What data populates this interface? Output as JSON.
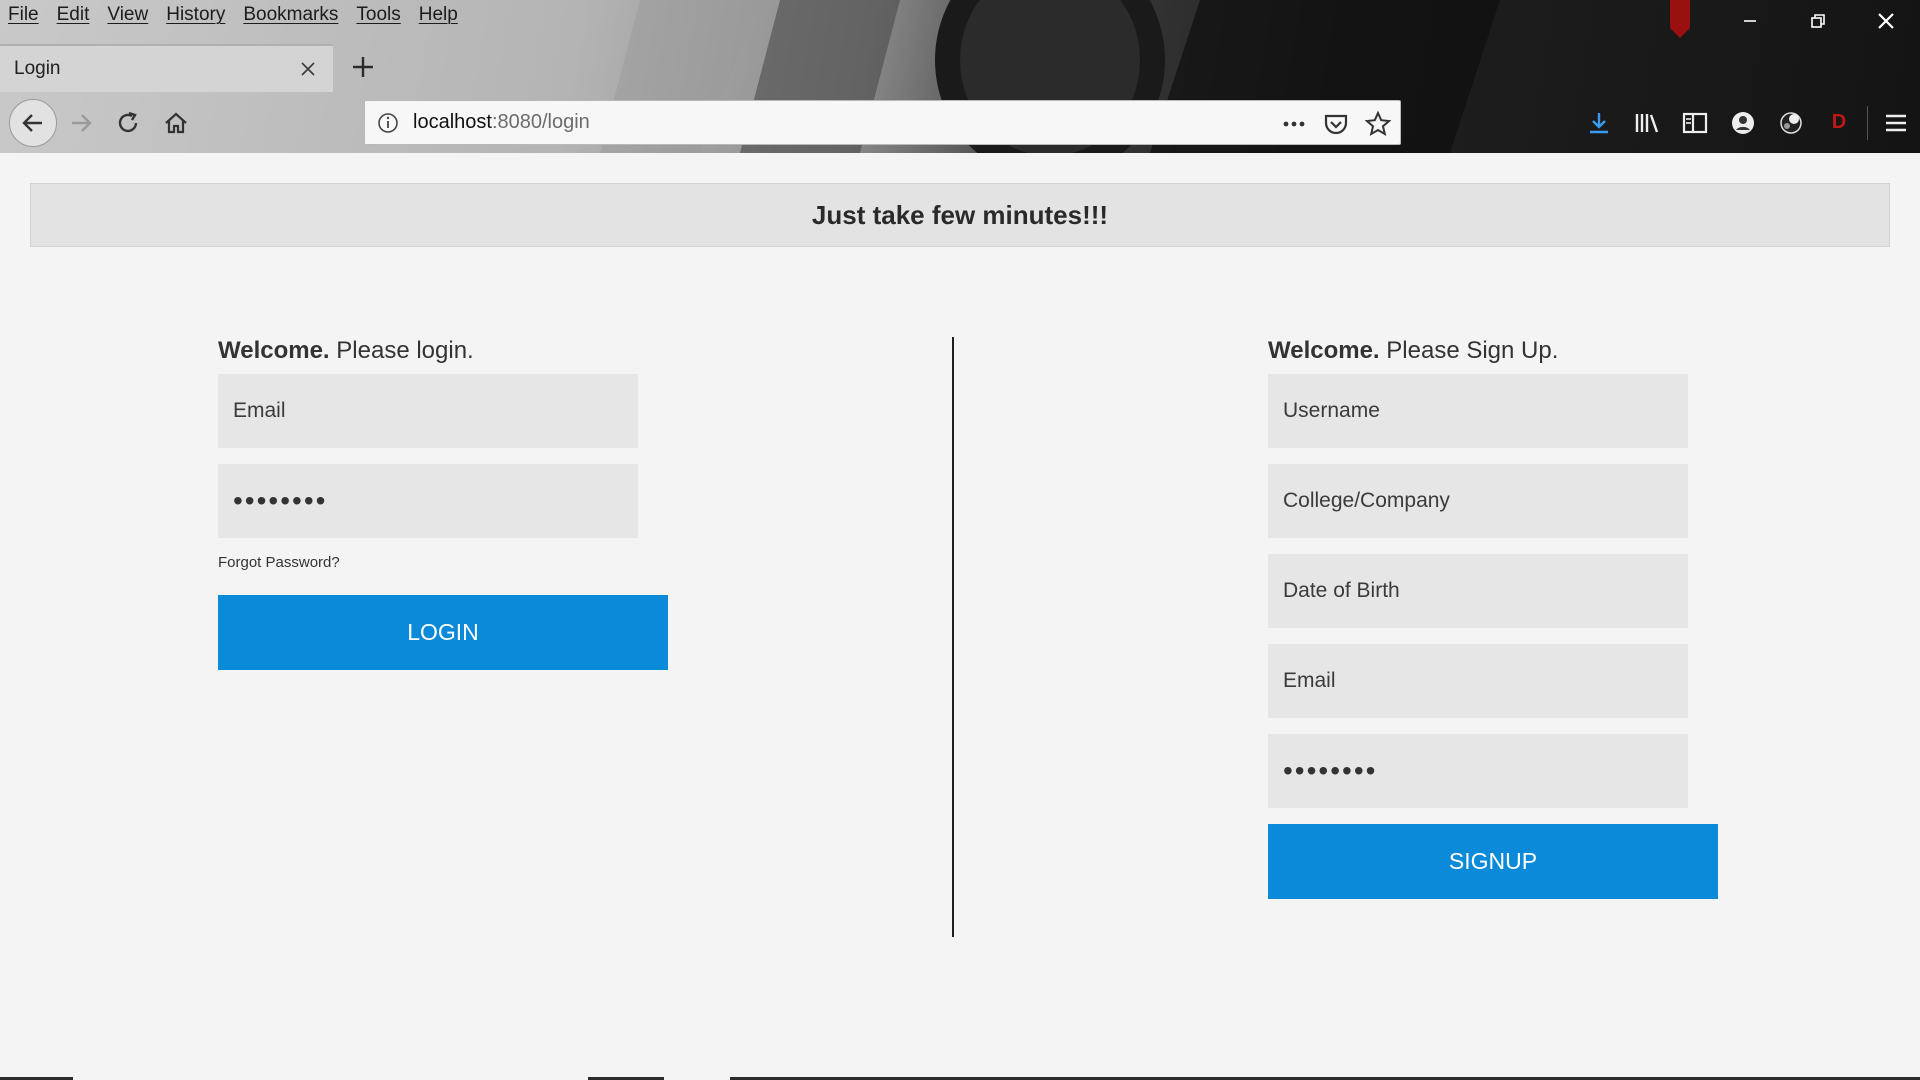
{
  "browser": {
    "menu": [
      "File",
      "Edit",
      "View",
      "History",
      "Bookmarks",
      "Tools",
      "Help"
    ],
    "tab_title": "Login",
    "url_host": "localhost",
    "url_rest": ":8080/login",
    "accent": "#3a9cf0",
    "icons": {
      "window": [
        "minimize-icon",
        "restore-icon",
        "close-icon"
      ],
      "toolbar": [
        "back-arrow-icon",
        "forward-arrow-icon",
        "reload-icon",
        "home-icon"
      ],
      "url": [
        "info-icon",
        "more-dots-icon",
        "pocket-icon",
        "star-icon"
      ],
      "right": [
        "download-icon",
        "library-icon",
        "sidebar-icon",
        "account-icon",
        "extension-icon",
        "extension-d-icon",
        "hamburger-menu-icon"
      ]
    },
    "extension_letter": "D"
  },
  "page": {
    "banner": "Just take few minutes!!!",
    "button_color": "#0a8ad8",
    "login": {
      "heading_bold": "Welcome.",
      "heading_rest": " Please login.",
      "email_placeholder": "Email",
      "password_value": "••••••••",
      "forgot": "Forgot Password?",
      "button": "LOGIN"
    },
    "signup": {
      "heading_bold": "Welcome.",
      "heading_rest": " Please Sign Up.",
      "username_placeholder": "Username",
      "college_placeholder": "College/Company",
      "dob_placeholder": "Date of Birth",
      "email_placeholder": "Email",
      "password_value": "••••••••",
      "button": "SIGNUP"
    }
  }
}
